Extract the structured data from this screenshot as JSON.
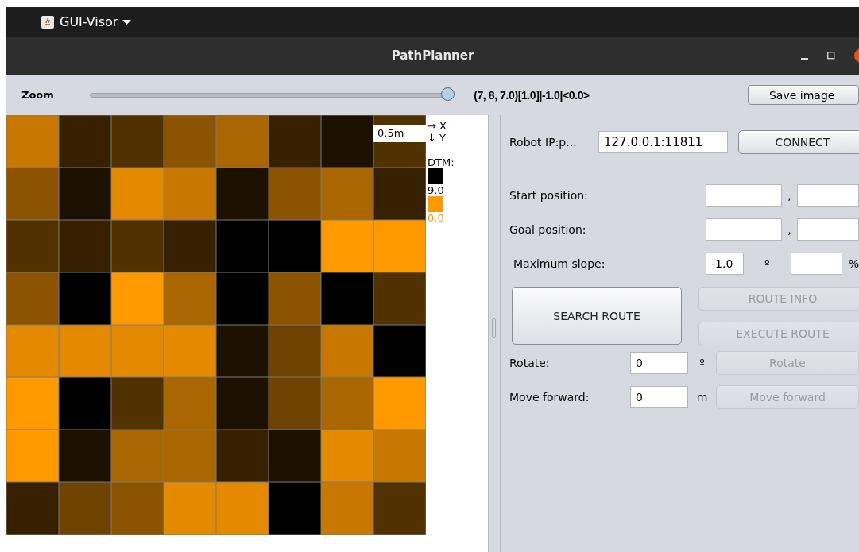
{
  "top_bar": {
    "app_name": "GUI-Visor"
  },
  "window": {
    "title": "PathPlanner"
  },
  "toolbar": {
    "zoom_label": "Zoom",
    "zoom_slider": {
      "level": 1.0
    },
    "status": "(7, 8, 7.0)[1.0]|-1.0|<0.0>",
    "save_button": "Save image"
  },
  "map": {
    "scale_label": "0.5m",
    "rows": [
      {
        "cells": [
          {
            "color": "#c87800"
          },
          {
            "color": "#362000"
          },
          {
            "color": "#523100"
          },
          {
            "color": "#8c5400"
          },
          {
            "color": "#aa6600"
          },
          {
            "color": "#362000"
          },
          {
            "color": "#1c1000"
          },
          {
            "color": "#523100"
          }
        ]
      },
      {
        "cells": [
          {
            "color": "#8c5400"
          },
          {
            "color": "#1c1000"
          },
          {
            "color": "#e58a00"
          },
          {
            "color": "#c87800"
          },
          {
            "color": "#1c1000"
          },
          {
            "color": "#8c5400"
          },
          {
            "color": "#aa6600"
          },
          {
            "color": "#362000"
          }
        ]
      },
      {
        "cells": [
          {
            "color": "#523100"
          },
          {
            "color": "#362000"
          },
          {
            "color": "#523100"
          },
          {
            "color": "#362000"
          },
          {
            "color": "#000000"
          },
          {
            "color": "#000000"
          },
          {
            "color": "#ff9900"
          },
          {
            "color": "#ff9900"
          }
        ]
      },
      {
        "cells": [
          {
            "color": "#8c5400"
          },
          {
            "color": "#000000"
          },
          {
            "color": "#ff9900"
          },
          {
            "color": "#aa6600"
          },
          {
            "color": "#000000"
          },
          {
            "color": "#8c5400"
          },
          {
            "color": "#000000"
          },
          {
            "color": "#523100"
          }
        ]
      },
      {
        "cells": [
          {
            "color": "#e58a00"
          },
          {
            "color": "#e58a00"
          },
          {
            "color": "#e58a00"
          },
          {
            "color": "#e58a00"
          },
          {
            "color": "#1c1000"
          },
          {
            "color": "#6e4200"
          },
          {
            "color": "#c87800"
          },
          {
            "color": "#000000"
          }
        ]
      },
      {
        "cells": [
          {
            "color": "#ff9900"
          },
          {
            "color": "#000000"
          },
          {
            "color": "#523100"
          },
          {
            "color": "#aa6600"
          },
          {
            "color": "#1c1000"
          },
          {
            "color": "#6e4200"
          },
          {
            "color": "#aa6600"
          },
          {
            "color": "#ff9900"
          }
        ]
      },
      {
        "cells": [
          {
            "color": "#ff9900"
          },
          {
            "color": "#1c1000"
          },
          {
            "color": "#aa6600"
          },
          {
            "color": "#aa6600"
          },
          {
            "color": "#362000"
          },
          {
            "color": "#1c1000"
          },
          {
            "color": "#e58a00"
          },
          {
            "color": "#c87800"
          }
        ]
      },
      {
        "cells": [
          {
            "color": "#362000"
          },
          {
            "color": "#6e4200"
          },
          {
            "color": "#8c5400"
          },
          {
            "color": "#e58a00"
          },
          {
            "color": "#e58a00"
          },
          {
            "color": "#000000"
          },
          {
            "color": "#c87800"
          },
          {
            "color": "#523100"
          }
        ]
      }
    ]
  },
  "legend": {
    "x_axis": "→ X",
    "y_axis": "↓ Y",
    "title": "DTM:",
    "entries": [
      {
        "color": "#000000",
        "value": "9.0"
      },
      {
        "color": "#ff9900",
        "value": "0.0"
      }
    ]
  },
  "controls": {
    "robot_ip": {
      "label": "Robot IP:p...",
      "value": "127.0.0.1:11811"
    },
    "connect_button": {
      "label": "CONNECT",
      "disabled": false
    },
    "start_position": {
      "label": "Start position:",
      "separator": ","
    },
    "goal_position": {
      "label": "Goal position:",
      "separator": ","
    },
    "max_slope": {
      "label": "Maximum slope:",
      "degrees_value": "-1.0",
      "degrees_unit": "º",
      "percent_unit": "%"
    },
    "search_button": {
      "label": "SEARCH ROUTE",
      "disabled": false
    },
    "route_info_button": {
      "label": "ROUTE INFO",
      "disabled": true
    },
    "execute_button": {
      "label": "EXECUTE ROUTE",
      "disabled": true
    },
    "rotate": {
      "label": "Rotate:",
      "value": "0",
      "unit": "º",
      "button": {
        "label": "Rotate",
        "disabled": true
      }
    },
    "move_forward": {
      "label": "Move forward:",
      "value": "0",
      "unit": "m",
      "button": {
        "label": "Move forward",
        "disabled": true
      }
    }
  }
}
